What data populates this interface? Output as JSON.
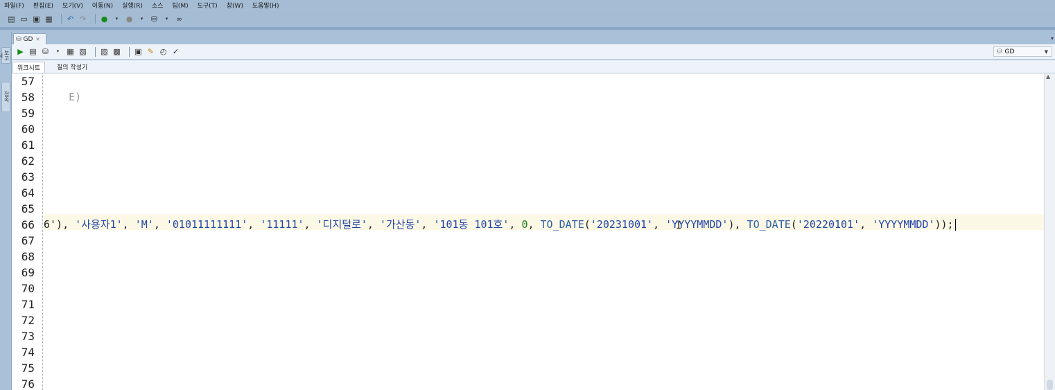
{
  "menu": [
    "파일(F)",
    "편집(E)",
    "보기(V)",
    "이동(N)",
    "실행(R)",
    "소스",
    "팀(M)",
    "도구(T)",
    "창(W)",
    "도움말(H)"
  ],
  "toolbar_icons": [
    "new-icon",
    "open-icon",
    "save-icon",
    "save-all-icon",
    "undo-icon",
    "redo-icon",
    "back-icon",
    "forward-icon",
    "sql-icon",
    "binoculars-icon"
  ],
  "editor": {
    "tab_label": "GD",
    "connection": "GD",
    "subtabs": [
      "워크시트",
      "질의 작성기"
    ]
  },
  "left_dock": [
    "보고서",
    "접속"
  ],
  "code": {
    "first_line": 57,
    "line_numbers": [
      "57",
      "58",
      "59",
      "60",
      "61",
      "62",
      "63",
      "64",
      "65",
      "66",
      "67",
      "68",
      "69",
      "70",
      "71",
      "72",
      "73",
      "74",
      "75",
      "76"
    ],
    "line57_fragment": "E)",
    "line66": {
      "prefix": "6'), ",
      "s1": "'사용자1'",
      "s2": "'M'",
      "s3": "'01011111111'",
      "s4": "'11111'",
      "s5": "'디지털로'",
      "s6": "'가산동'",
      "s7": "'101동 101호'",
      "n1": "0",
      "fn1": "TO_DATE",
      "s8": "'20231001'",
      "s9": "'YYYYMMDD'",
      "fn2": "TO_DATE",
      "s10": "'20220101'",
      "s11": "'YYYYMMDD'",
      "suffix": "));"
    }
  },
  "colors": {
    "accent": "#a4bdd5",
    "string": "#2244aa",
    "current_line": "#fbf8e6"
  }
}
